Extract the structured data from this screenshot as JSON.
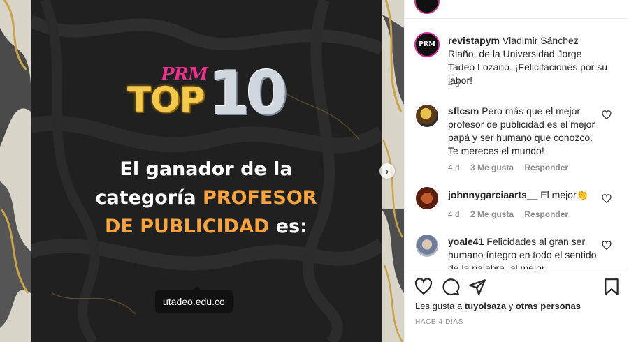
{
  "post": {
    "logo_prm": "PRM",
    "logo_top": "TOP",
    "logo_ten": "10",
    "headline_line1": "El ganador de la",
    "headline_line2_a": "categoría ",
    "headline_line2_b": "PROFESOR",
    "headline_line3_a": "DE PUBLICIDAD",
    "headline_line3_b": " es:",
    "source_tag": "utadeo.edu.co",
    "next_icon": "chevron-right-icon",
    "accent_color": "#f7a440"
  },
  "caption": {
    "username": "revistapym",
    "avatar_text": "PRM",
    "text": "Vladimir Sánchez Riaño, de la Universidad Jorge Tadeo Lozano. ¡Felicitaciones por su labor!",
    "time": "4 d"
  },
  "comments": [
    {
      "username": "sflcsm",
      "text": "Pero más que el mejor profesor de publicidad es el mejor papá y ser humano que conozco. Te mereces el mundo!",
      "time": "4 d",
      "likes": "3 Me gusta",
      "reply": "Responder"
    },
    {
      "username": "johnnygarciaarts__",
      "text": "El mejor👏",
      "time": "4 d",
      "likes": "2 Me gusta",
      "reply": "Responder"
    },
    {
      "username": "yoale41",
      "text": "Felicidades al gran ser humano íntegro en todo el sentido de la palabra, al mejor"
    }
  ],
  "actions": {
    "icons": [
      "heart-icon",
      "comment-icon",
      "share-icon",
      "bookmark-icon"
    ],
    "likes_prefix": "Les gusta a ",
    "likes_user": "tuyoisaza",
    "likes_middle": " y ",
    "likes_others": "otras personas",
    "timestamp": "HACE 4 DÍAS"
  }
}
